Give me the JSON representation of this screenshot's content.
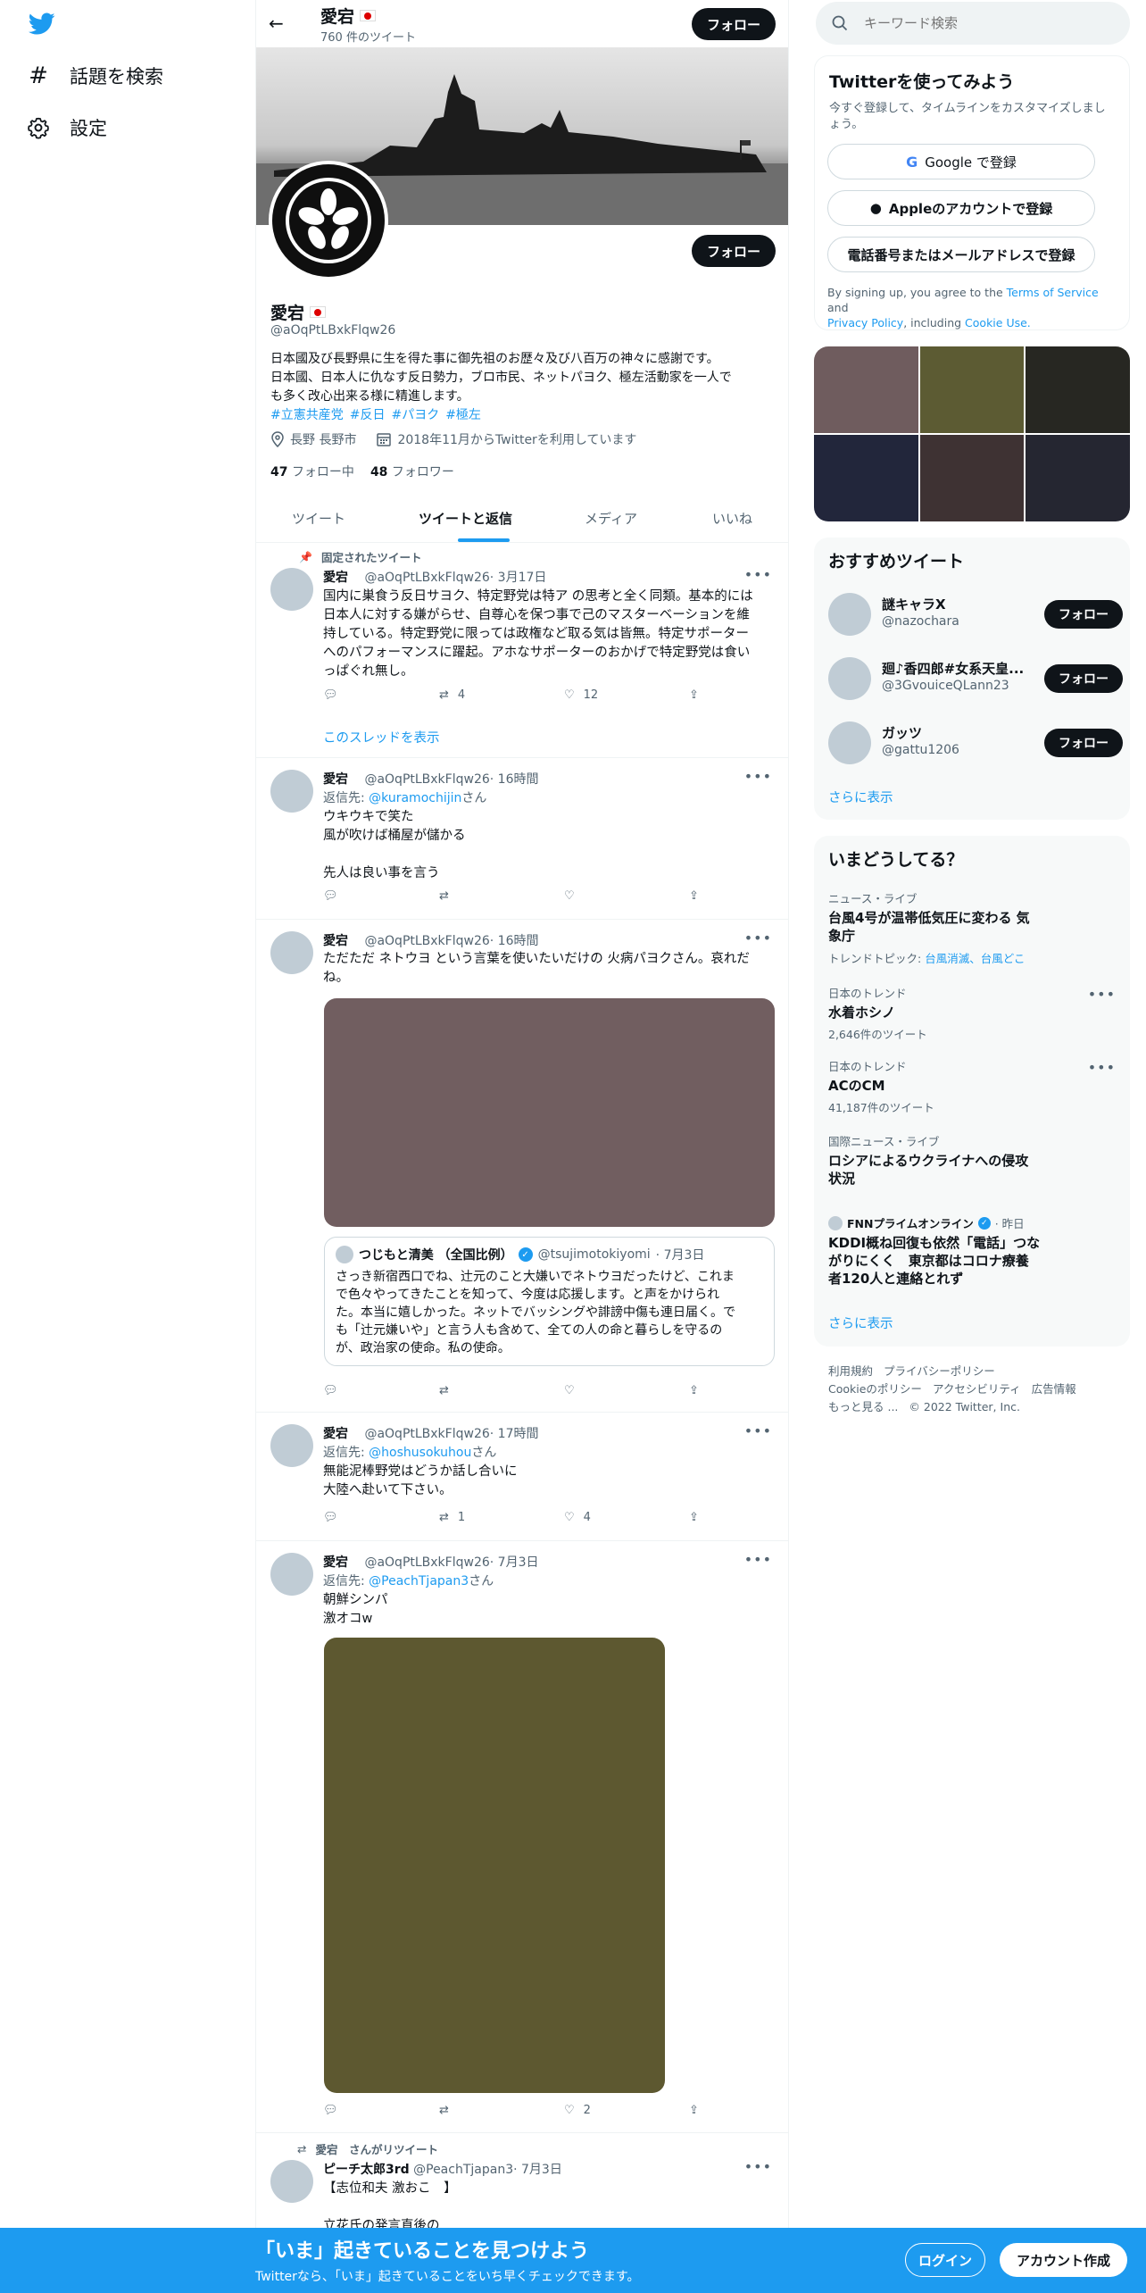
{
  "nav": {
    "explore_label": "話題を検索",
    "settings_label": "設定"
  },
  "header": {
    "name": "愛宕",
    "tweet_count": "760 件のツイート",
    "follow_label": "フォロー"
  },
  "profile": {
    "name": "愛宕",
    "handle": "@aOqPtLBxkFlqw26",
    "bio_line1": "日本國及び長野県に生を得た事に御先祖のお歴々及び八百万の神々に感謝です。",
    "bio_line2": "日本國、日本人に仇なす反日勢力，ブロ市民、ネットパヨク、極左活動家を一人で",
    "bio_line3": "も多く改心出来る様に精進します。",
    "hashtags": [
      "#立憲共産党",
      "#反日",
      "#パヨク",
      "#極左"
    ],
    "location": "長野 長野市",
    "joined": "2018年11月からTwitterを利用しています",
    "following_count": "47",
    "following_label": "フォロー中",
    "followers_count": "48",
    "followers_label": "フォロワー",
    "follow_label": "フォロー"
  },
  "tabs": [
    {
      "label": "ツイート"
    },
    {
      "label": "ツイートと返信"
    },
    {
      "label": "メディア"
    },
    {
      "label": "いいね"
    }
  ],
  "tweets": {
    "t1": {
      "pinned": "固定されたツイート",
      "name": "愛宕",
      "handle": "@aOqPtLBxkFlqw26",
      "time": "· 3月17日",
      "lines": [
        "国内に巣食う反日サヨク、特定野党は特ア の思考と全く同類。基本的には",
        "日本人に対する嫌がらせ、自尊心を保つ事で己のマスターベーションを維",
        "持している。特定野党に限っては政権など取る気は皆無。特定サポーター",
        "へのパフォーマンスに躍起。アホなサポーターのおかげで特定野党は食い",
        "っぱぐれ無し。"
      ],
      "retweets": "4",
      "likes": "12",
      "thread_link": "このスレッドを表示"
    },
    "t2": {
      "name": "愛宕",
      "handle": "@aOqPtLBxkFlqw26",
      "time": "· 16時間",
      "reply_prefix": "返信先: ",
      "reply_to": "@kuramochijin",
      "reply_suffix": "さん",
      "lines": [
        "ウキウキで笑た",
        "風が吹けば桶屋が儲かる",
        "",
        "先人は良い事を言う"
      ]
    },
    "t3": {
      "name": "愛宕",
      "handle": "@aOqPtLBxkFlqw26",
      "time": "· 16時間",
      "lines": [
        "ただただ ネトウヨ という言葉を使いたいだけの 火病パヨクさん。哀れだ",
        "ね。"
      ],
      "media_color": "#715e60",
      "quote": {
        "name": "つじもと清美 （全国比例）",
        "handle": "@tsujimotokiyomi",
        "time": "· 7月3日",
        "lines": [
          "さっき新宿西口でね、辻元のこと大嫌いでネトウヨだったけど、これま",
          "で色々やってきたことを知って、今度は応援します。と声をかけられ",
          "た。本当に嬉しかった。ネットでバッシングや誹謗中傷も連日届く。で",
          "も「辻元嫌いや」と言う人も含めて、全ての人の命と暮らしを守るの",
          "が、政治家の使命。私の使命。"
        ]
      }
    },
    "t4": {
      "name": "愛宕",
      "handle": "@aOqPtLBxkFlqw26",
      "time": "· 17時間",
      "reply_prefix": "返信先: ",
      "reply_to": "@hoshusokuhou",
      "reply_suffix": "さん",
      "lines": [
        "無能泥棒野党はどうか話し合いに",
        "大陸へ赴いて下さい。"
      ],
      "retweets": "1",
      "likes": "4"
    },
    "t5": {
      "name": "愛宕",
      "handle": "@aOqPtLBxkFlqw26",
      "time": "· 7月3日",
      "reply_prefix": "返信先: ",
      "reply_to": "@PeachTjapan3",
      "reply_suffix": "さん",
      "lines": [
        "朝鮮シンパ",
        "激オコw"
      ],
      "media_color": "#5d5830",
      "likes": "2"
    },
    "t6": {
      "retweet_by": "愛宕　さんがリツイート",
      "name": "ピーチ太郎3rd",
      "handle": "@PeachTjapan3",
      "time": "· 7月3日",
      "lines": [
        "【志位和夫 激おこ　】",
        "",
        "立花氏の発言直後の"
      ]
    }
  },
  "right": {
    "search_placeholder": "キーワード検索",
    "signup": {
      "title": "Twitterを使ってみよう",
      "desc_line1": "今すぐ登録して、タイムラインをカスタマイズしまし",
      "desc_line2": "ょう。",
      "google": "Google で登録",
      "apple": "Appleのアカウントで登録",
      "phone": "電話番号またはメールアドレスで登録",
      "legal_1": "By signing up, you agree to the ",
      "legal_tos": "Terms of Service",
      "legal_2": " and",
      "legal_privacy": "Privacy Policy",
      "legal_3": ", including ",
      "legal_cookie": "Cookie Use."
    },
    "media_colors": [
      "#6f5c5e",
      "#5c5b33",
      "#272722",
      "#22263b",
      "#3e3233",
      "#252631"
    ],
    "who_to_follow": {
      "title": "おすすめツイート",
      "users": [
        {
          "name": "謎キャラX",
          "handle": "@nazochara",
          "button": "フォロー"
        },
        {
          "name": "廻♪香四郎#女系天皇...",
          "handle": "@3GvouiceQLann23",
          "button": "フォロー"
        },
        {
          "name": "ガッツ",
          "handle": "@gattu1206",
          "button": "フォロー"
        }
      ],
      "more": "さらに表示"
    },
    "trends": {
      "title": "いまどうしてる？",
      "items": [
        {
          "category": "ニュース・ライブ",
          "title_line1": "台風4号が温帯低気圧に変わる 気",
          "title_line2": "象庁",
          "topic_prefix": "トレンドトピック: ",
          "topic_links": "台風消滅、台風どこ"
        },
        {
          "category": "日本のトレンド",
          "title_line1": "水着ホシノ",
          "count": "2,646件のツイート"
        },
        {
          "category": "日本のトレンド",
          "title_line1": "ACのCM",
          "count": "41,187件のツイート"
        },
        {
          "category": "国際ニュース・ライブ",
          "title_line1": "ロシアによるウクライナへの侵攻",
          "title_line2": "状況"
        },
        {
          "source": "FNNプライムオンライン",
          "time": "· 昨日",
          "title_line1": "KDDI概ね回復も依然「電話」つな",
          "title_line2": "がりにくく　東京都はコロナ療養",
          "title_line3": "者120人と連絡とれず"
        }
      ],
      "more": "さらに表示"
    },
    "footer": {
      "line1": [
        "利用規約",
        "プライバシーポリシー"
      ],
      "line2": [
        "Cookieのポリシー",
        "アクセシビリティ",
        "広告情報"
      ],
      "line3": [
        "もっと見る ...",
        "© 2022 Twitter, Inc."
      ]
    }
  },
  "bottom": {
    "title": "「いま」起きていることを見つけよう",
    "subtitle": "Twitterなら、「いま」起きていることをいち早くチェックできます。",
    "login": "ログイン",
    "signup": "アカウント作成"
  }
}
